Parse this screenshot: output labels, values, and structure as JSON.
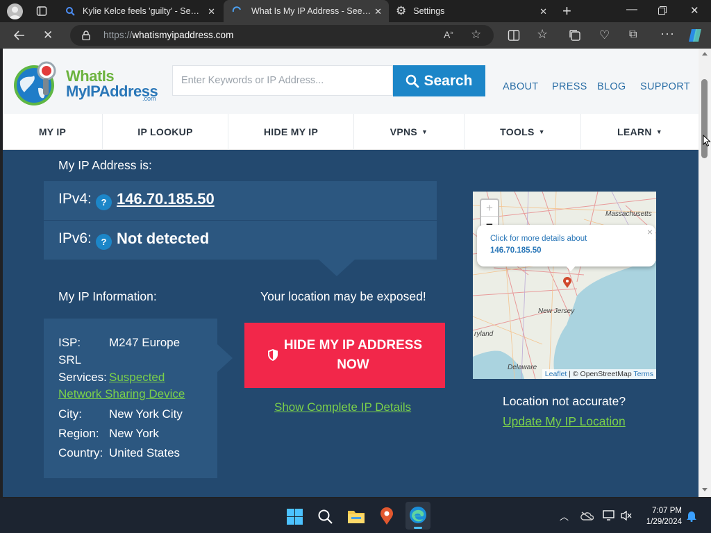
{
  "browser": {
    "tabs": [
      {
        "title": "Kylie Kelce feels 'guilty' - Search"
      },
      {
        "title": "What Is My IP Address - See You"
      },
      {
        "title": "Settings"
      }
    ],
    "url_scheme": "https://",
    "url_host": "whatismyipaddress.com"
  },
  "site": {
    "logo_line1": "WhatIs",
    "logo_line2": "MyIPAddress",
    "logo_com": ".com",
    "search_placeholder": "Enter Keywords or IP Address...",
    "search_button": "Search",
    "top_links": [
      "ABOUT",
      "PRESS",
      "BLOG",
      "SUPPORT"
    ],
    "nav": [
      {
        "label": "MY IP",
        "dropdown": false
      },
      {
        "label": "IP LOOKUP",
        "dropdown": false
      },
      {
        "label": "HIDE MY IP",
        "dropdown": false
      },
      {
        "label": "VPNS",
        "dropdown": true
      },
      {
        "label": "TOOLS",
        "dropdown": true
      },
      {
        "label": "LEARN",
        "dropdown": true
      }
    ]
  },
  "main": {
    "ip_heading": "My IP Address is:",
    "ipv4_label": "IPv4:",
    "ipv4_value": "146.70.185.50",
    "ipv6_label": "IPv6:",
    "ipv6_value": "Not detected",
    "help_glyph": "?",
    "info_heading": "My IP Information:",
    "info": {
      "isp_label": "ISP:",
      "isp_value_1": "M247 Europe",
      "isp_value_2": "SRL",
      "services_label": "Services:",
      "services_value_1": "Suspected",
      "services_value_2": "Network Sharing Device",
      "city_label": "City:",
      "city_value": "New York City",
      "region_label": "Region:",
      "region_value": "New York",
      "country_label": "Country:",
      "country_value": "United States"
    },
    "warning": "Your location may be exposed!",
    "hide_btn_1": "HIDE MY IP ADDRESS",
    "hide_btn_2": "NOW",
    "details_link": "Show Complete IP Details",
    "map": {
      "popup_line1": "Click for more details about",
      "popup_line2": "146.70.185.50",
      "zoom_in": "+",
      "zoom_out": "−",
      "popup_close": "×",
      "place_ma": "Massachusetts",
      "place_nj": "New Jersey",
      "place_md": "ryland",
      "place_de": "Delaware",
      "attr_leaflet": "Leaflet",
      "attr_osm": "| © OpenStreetMap",
      "attr_terms": "Terms"
    },
    "loc_question": "Location not accurate?",
    "loc_link": "Update My IP Location"
  },
  "taskbar": {
    "time": "7:07 PM",
    "date": "1/29/2024"
  },
  "colors": {
    "brand_blue": "#1c86c8",
    "page_bg": "#23496f",
    "panel_bg": "#2c5780",
    "alert_red": "#f2274a",
    "link_green": "#7bd04a"
  }
}
